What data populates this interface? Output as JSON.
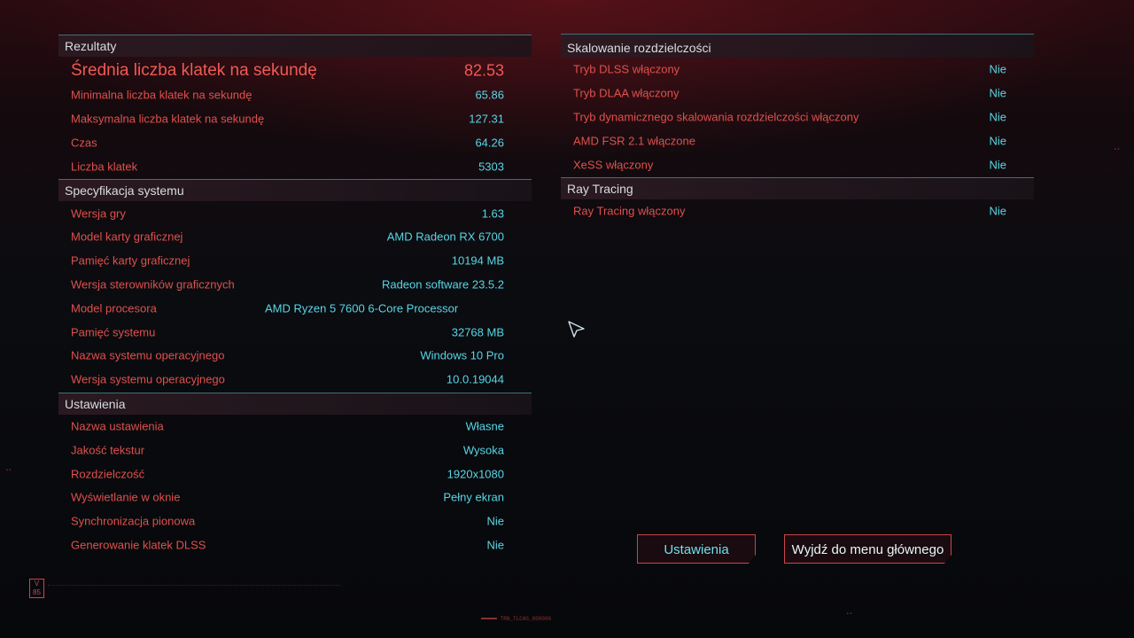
{
  "results": {
    "title": "Rezultaty",
    "rows": [
      {
        "label": "Średnia liczba klatek na sekundę",
        "value": "82.53"
      },
      {
        "label": "Minimalna liczba klatek na sekundę",
        "value": "65.86"
      },
      {
        "label": "Maksymalna liczba klatek na sekundę",
        "value": "127.31"
      },
      {
        "label": "Czas",
        "value": "64.26"
      },
      {
        "label": "Liczba klatek",
        "value": "5303"
      }
    ]
  },
  "system": {
    "title": "Specyfikacja systemu",
    "rows": [
      {
        "label": "Wersja gry",
        "value": "1.63"
      },
      {
        "label": "Model karty graficznej",
        "value": "AMD Radeon RX 6700"
      },
      {
        "label": "Pamięć karty graficznej",
        "value": "10194 MB"
      },
      {
        "label": "Wersja sterowników graficznych",
        "value": "Radeon software 23.5.2"
      },
      {
        "label": "Model procesora",
        "value": "AMD Ryzen 5 7600 6-Core Processor"
      },
      {
        "label": "Pamięć systemu",
        "value": "32768 MB"
      },
      {
        "label": "Nazwa systemu operacyjnego",
        "value": "Windows 10 Pro"
      },
      {
        "label": "Wersja systemu operacyjnego",
        "value": "10.0.19044"
      }
    ]
  },
  "settings": {
    "title": "Ustawienia",
    "rows": [
      {
        "label": "Nazwa ustawienia",
        "value": "Własne"
      },
      {
        "label": "Jakość tekstur",
        "value": "Wysoka"
      },
      {
        "label": "Rozdzielczość",
        "value": "1920x1080"
      },
      {
        "label": "Wyświetlanie w oknie",
        "value": "Pełny ekran"
      },
      {
        "label": "Synchronizacja pionowa",
        "value": "Nie"
      },
      {
        "label": "Generowanie klatek DLSS",
        "value": "Nie"
      }
    ]
  },
  "scaling": {
    "title": "Skalowanie rozdzielczości",
    "rows": [
      {
        "label": "Tryb DLSS włączony",
        "value": "Nie"
      },
      {
        "label": "Tryb DLAA włączony",
        "value": "Nie"
      },
      {
        "label": "Tryb dynamicznego skalowania rozdzielczości włączony",
        "value": "Nie"
      },
      {
        "label": "AMD FSR 2.1 włączone",
        "value": "Nie"
      },
      {
        "label": "XeSS włączony",
        "value": "Nie"
      }
    ]
  },
  "raytracing": {
    "title": "Ray Tracing",
    "rows": [
      {
        "label": "Ray Tracing włączony",
        "value": "Nie"
      }
    ]
  },
  "buttons": {
    "settings": "Ustawienia",
    "exit": "Wyjdź do menu głównego"
  },
  "footer": {
    "badge": "V 85",
    "code": "TRN_TLCAS_800096"
  },
  "colors": {
    "label": "#e0504c",
    "value": "#57d6e6",
    "header_text": "#d8dde0",
    "accent_line": "#3f6f78",
    "button_border": "#c9474a"
  },
  "icons": {
    "cursor": "arrow-cursor-icon",
    "badge": "v85-logo-icon"
  }
}
